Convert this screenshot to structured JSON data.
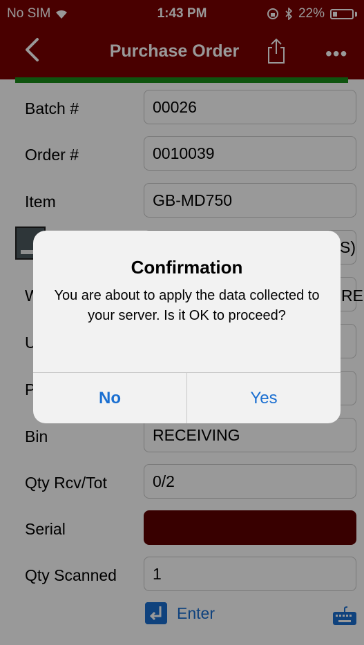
{
  "status_bar": {
    "carrier": "No SIM",
    "time": "1:43 PM",
    "battery": "22%"
  },
  "nav": {
    "back": "<",
    "title": "Purchase Order",
    "more": "•••"
  },
  "form": {
    "batch": {
      "label": "Batch #",
      "value": "00026"
    },
    "order": {
      "label": "Order #",
      "value": "0010039"
    },
    "item": {
      "label": "Item",
      "value": "GB-MD750"
    },
    "desc_tail": "S)",
    "wh_label_partial": "W",
    "wh_value_tail": "RE",
    "uom_label_partial": "U",
    "p_label_partial": "P",
    "bin": {
      "label": "Bin",
      "value": "RECEIVING"
    },
    "qty_rcv_tot": {
      "label": "Qty Rcv/Tot",
      "value": "0/2"
    },
    "serial": {
      "label": "Serial",
      "value": ""
    },
    "qty_scanned": {
      "label": "Qty Scanned",
      "value": "1"
    },
    "enter_label": "Enter"
  },
  "alert": {
    "title": "Confirmation",
    "message": "You are about to apply the data collected to your server.  Is it OK to proceed?",
    "no_label": "No",
    "yes_label": "Yes"
  },
  "colors": {
    "brand": "#7a0000",
    "accent": "#1a6fd1",
    "progress": "#1a8c1a",
    "serial_field": "#5e0000"
  }
}
